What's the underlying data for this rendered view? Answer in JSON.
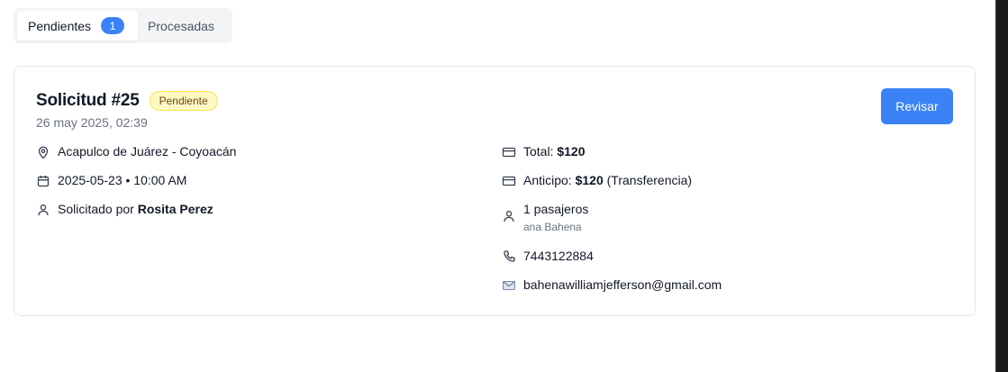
{
  "tabs": [
    {
      "label": "Pendientes",
      "count": "1",
      "active": true
    },
    {
      "label": "Procesadas",
      "active": false
    }
  ],
  "request": {
    "title": "Solicitud #25",
    "status": "Pendiente",
    "date": "26 may 2025, 02:39",
    "review_label": "Revisar",
    "route": "Acapulco de Juárez - Coyoacán",
    "schedule": "2025-05-23 • 10:00 AM",
    "requested_by_prefix": "Solicitado por",
    "requested_by_name": "Rosita Perez",
    "total_label": "Total:",
    "total_value": "$120",
    "advance_label": "Anticipo:",
    "advance_value": "$120",
    "advance_method": "(Transferencia)",
    "passengers": "1 pasajeros",
    "passenger_name": "ana Bahena",
    "phone": "7443122884",
    "email": "bahenawilliamjefferson@gmail.com"
  },
  "icons": {
    "route": "map-pin-icon",
    "schedule": "calendar-icon",
    "requester": "user-icon",
    "total": "credit-card-icon",
    "advance": "credit-card-icon",
    "passengers": "user-icon",
    "phone": "phone-icon",
    "email": "envelope-icon"
  },
  "colors": {
    "accent": "#3b82f6",
    "badge_bg": "#fef9c3",
    "badge_border": "#fde047",
    "badge_text": "#713f12"
  }
}
